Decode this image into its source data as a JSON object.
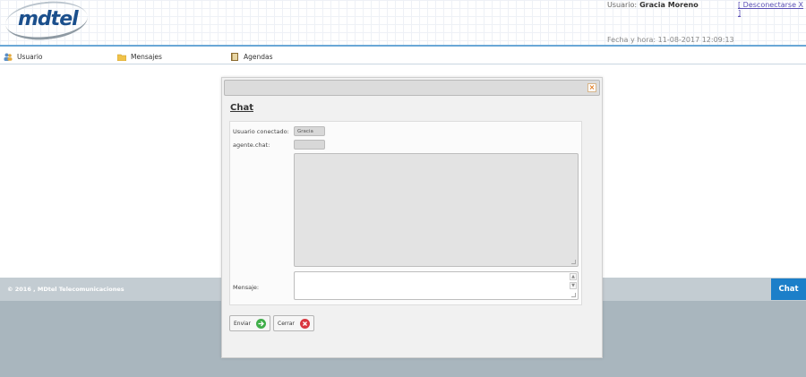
{
  "header": {
    "logo_text": "mdtel",
    "user_prefix": "Usuario:",
    "user_name": "Gracia Moreno",
    "logout_label": "[ Desconectarse X ]",
    "datetime": "Fecha y hora: 11-08-2017 12:09:13"
  },
  "menu": {
    "items": [
      {
        "label": "Usuario",
        "icon": "user-icon"
      },
      {
        "label": "Mensajes",
        "icon": "folder-icon"
      },
      {
        "label": "Agendas",
        "icon": "book-icon"
      }
    ]
  },
  "dialog": {
    "title": "Chat",
    "close_icon": "close-icon",
    "connected_label": "Usuario conectado:",
    "connected_value": "Gracia",
    "agent_label": "agente.chat:",
    "agent_value": "",
    "message_label": "Mensaje:",
    "message_value": "",
    "send_label": "Enviar",
    "close_label": "Cerrar"
  },
  "footer": {
    "copyright": "© 2016 , MDtel Telecomunicaciones",
    "chat_tab": "Chat"
  },
  "colors": {
    "accent": "#1c7fc9",
    "footer": "#a9b6be",
    "send_icon": "#3fae49",
    "close_icon": "#d9363e"
  }
}
